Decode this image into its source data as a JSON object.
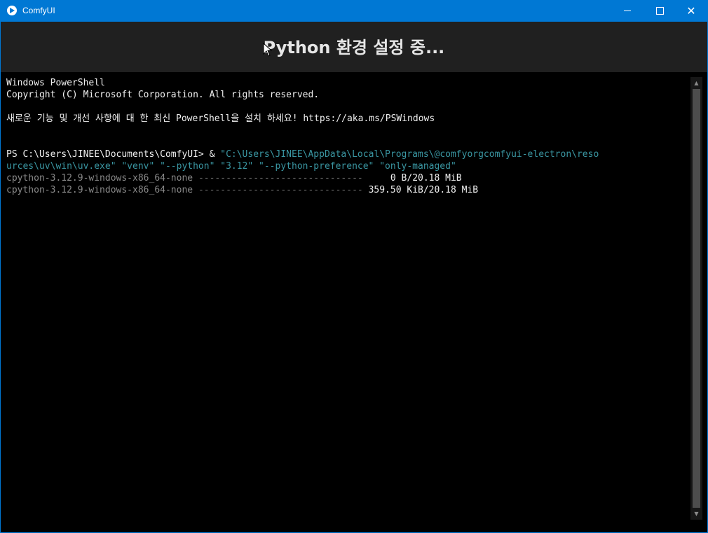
{
  "window": {
    "title": "ComfyUI",
    "icons": {
      "app": "comfyui-app-icon",
      "minimize": "minimize-icon",
      "maximize": "maximize-icon",
      "close": "close-icon"
    }
  },
  "header": {
    "title": "Python 환경 설정 중..."
  },
  "terminal": {
    "line1": "Windows PowerShell",
    "line2": "Copyright (C) Microsoft Corporation. All rights reserved.",
    "line3": "새로운 기능 및 개선 사항에 대 한 최신 PowerShell을 설치 하세요! https://aka.ms/PSWindows",
    "prompt": "PS C:\\Users\\JINEE\\Documents\\ComfyUI> ",
    "amp": "& ",
    "cmd_part1": "\"C:\\Users\\JINEE\\AppData\\Local\\Programs\\@comfyorgcomfyui-electron\\reso",
    "cmd_part2": "urces\\uv\\win\\uv.exe\" \"venv\" \"--python\" \"3.12\" \"--python-preference\" \"only-managed\"",
    "dl1_name": "cpython-3.12.9-windows-x86_64-none ",
    "dl1_bar": "------------------------------",
    "dl1_size": "     0 B/20.18 MiB",
    "dl2_name": "cpython-3.12.9-windows-x86_64-none ",
    "dl2_bar": "------------------------------",
    "dl2_size": " 359.50 KiB/20.18 MiB"
  },
  "colors": {
    "titlebar": "#0078d4",
    "header_bg": "#202020",
    "terminal_bg": "#000000",
    "command": "#3a96a2"
  }
}
